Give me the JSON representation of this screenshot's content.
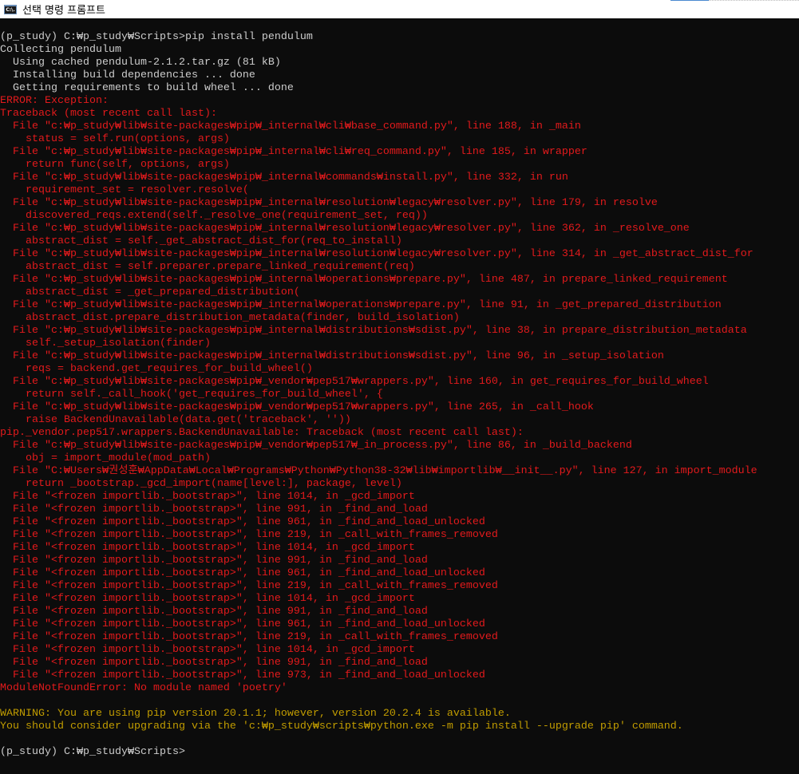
{
  "window": {
    "title": "선택 명령 프롬프트",
    "icon": "cmd-icon",
    "icon_text": "C:\\."
  },
  "colors": {
    "background": "#0c0c0c",
    "default": "#cccccc",
    "red": "#e31a1c",
    "yellow": "#c19c00"
  },
  "console_lines": [
    {
      "text": "(p_study) C:₩p_study₩Scripts>pip install pendulum",
      "color": "default"
    },
    {
      "text": "Collecting pendulum",
      "color": "default"
    },
    {
      "text": "  Using cached pendulum-2.1.2.tar.gz (81 kB)",
      "color": "default"
    },
    {
      "text": "  Installing build dependencies ... done",
      "color": "default"
    },
    {
      "text": "  Getting requirements to build wheel ... done",
      "color": "default"
    },
    {
      "text": "ERROR: Exception:",
      "color": "red"
    },
    {
      "text": "Traceback (most recent call last):",
      "color": "red"
    },
    {
      "text": "  File \"c:₩p_study₩lib₩site-packages₩pip₩_internal₩cli₩base_command.py\", line 188, in _main",
      "color": "red"
    },
    {
      "text": "    status = self.run(options, args)",
      "color": "red"
    },
    {
      "text": "  File \"c:₩p_study₩lib₩site-packages₩pip₩_internal₩cli₩req_command.py\", line 185, in wrapper",
      "color": "red"
    },
    {
      "text": "    return func(self, options, args)",
      "color": "red"
    },
    {
      "text": "  File \"c:₩p_study₩lib₩site-packages₩pip₩_internal₩commands₩install.py\", line 332, in run",
      "color": "red"
    },
    {
      "text": "    requirement_set = resolver.resolve(",
      "color": "red"
    },
    {
      "text": "  File \"c:₩p_study₩lib₩site-packages₩pip₩_internal₩resolution₩legacy₩resolver.py\", line 179, in resolve",
      "color": "red"
    },
    {
      "text": "    discovered_reqs.extend(self._resolve_one(requirement_set, req))",
      "color": "red"
    },
    {
      "text": "  File \"c:₩p_study₩lib₩site-packages₩pip₩_internal₩resolution₩legacy₩resolver.py\", line 362, in _resolve_one",
      "color": "red"
    },
    {
      "text": "    abstract_dist = self._get_abstract_dist_for(req_to_install)",
      "color": "red"
    },
    {
      "text": "  File \"c:₩p_study₩lib₩site-packages₩pip₩_internal₩resolution₩legacy₩resolver.py\", line 314, in _get_abstract_dist_for",
      "color": "red"
    },
    {
      "text": "    abstract_dist = self.preparer.prepare_linked_requirement(req)",
      "color": "red"
    },
    {
      "text": "  File \"c:₩p_study₩lib₩site-packages₩pip₩_internal₩operations₩prepare.py\", line 487, in prepare_linked_requirement",
      "color": "red"
    },
    {
      "text": "    abstract_dist = _get_prepared_distribution(",
      "color": "red"
    },
    {
      "text": "  File \"c:₩p_study₩lib₩site-packages₩pip₩_internal₩operations₩prepare.py\", line 91, in _get_prepared_distribution",
      "color": "red"
    },
    {
      "text": "    abstract_dist.prepare_distribution_metadata(finder, build_isolation)",
      "color": "red"
    },
    {
      "text": "  File \"c:₩p_study₩lib₩site-packages₩pip₩_internal₩distributions₩sdist.py\", line 38, in prepare_distribution_metadata",
      "color": "red"
    },
    {
      "text": "    self._setup_isolation(finder)",
      "color": "red"
    },
    {
      "text": "  File \"c:₩p_study₩lib₩site-packages₩pip₩_internal₩distributions₩sdist.py\", line 96, in _setup_isolation",
      "color": "red"
    },
    {
      "text": "    reqs = backend.get_requires_for_build_wheel()",
      "color": "red"
    },
    {
      "text": "  File \"c:₩p_study₩lib₩site-packages₩pip₩_vendor₩pep517₩wrappers.py\", line 160, in get_requires_for_build_wheel",
      "color": "red"
    },
    {
      "text": "    return self._call_hook('get_requires_for_build_wheel', {",
      "color": "red"
    },
    {
      "text": "  File \"c:₩p_study₩lib₩site-packages₩pip₩_vendor₩pep517₩wrappers.py\", line 265, in _call_hook",
      "color": "red"
    },
    {
      "text": "    raise BackendUnavailable(data.get('traceback', ''))",
      "color": "red"
    },
    {
      "text": "pip._vendor.pep517.wrappers.BackendUnavailable: Traceback (most recent call last):",
      "color": "red"
    },
    {
      "text": "  File \"c:₩p_study₩lib₩site-packages₩pip₩_vendor₩pep517₩_in_process.py\", line 86, in _build_backend",
      "color": "red"
    },
    {
      "text": "    obj = import_module(mod_path)",
      "color": "red"
    },
    {
      "text": "  File \"C:₩Users₩권성훈₩AppData₩Local₩Programs₩Python₩Python38-32₩lib₩importlib₩__init__.py\", line 127, in import_module",
      "color": "red"
    },
    {
      "text": "    return _bootstrap._gcd_import(name[level:], package, level)",
      "color": "red"
    },
    {
      "text": "  File \"<frozen importlib._bootstrap>\", line 1014, in _gcd_import",
      "color": "red"
    },
    {
      "text": "  File \"<frozen importlib._bootstrap>\", line 991, in _find_and_load",
      "color": "red"
    },
    {
      "text": "  File \"<frozen importlib._bootstrap>\", line 961, in _find_and_load_unlocked",
      "color": "red"
    },
    {
      "text": "  File \"<frozen importlib._bootstrap>\", line 219, in _call_with_frames_removed",
      "color": "red"
    },
    {
      "text": "  File \"<frozen importlib._bootstrap>\", line 1014, in _gcd_import",
      "color": "red"
    },
    {
      "text": "  File \"<frozen importlib._bootstrap>\", line 991, in _find_and_load",
      "color": "red"
    },
    {
      "text": "  File \"<frozen importlib._bootstrap>\", line 961, in _find_and_load_unlocked",
      "color": "red"
    },
    {
      "text": "  File \"<frozen importlib._bootstrap>\", line 219, in _call_with_frames_removed",
      "color": "red"
    },
    {
      "text": "  File \"<frozen importlib._bootstrap>\", line 1014, in _gcd_import",
      "color": "red"
    },
    {
      "text": "  File \"<frozen importlib._bootstrap>\", line 991, in _find_and_load",
      "color": "red"
    },
    {
      "text": "  File \"<frozen importlib._bootstrap>\", line 961, in _find_and_load_unlocked",
      "color": "red"
    },
    {
      "text": "  File \"<frozen importlib._bootstrap>\", line 219, in _call_with_frames_removed",
      "color": "red"
    },
    {
      "text": "  File \"<frozen importlib._bootstrap>\", line 1014, in _gcd_import",
      "color": "red"
    },
    {
      "text": "  File \"<frozen importlib._bootstrap>\", line 991, in _find_and_load",
      "color": "red"
    },
    {
      "text": "  File \"<frozen importlib._bootstrap>\", line 973, in _find_and_load_unlocked",
      "color": "red"
    },
    {
      "text": "ModuleNotFoundError: No module named 'poetry'",
      "color": "red"
    },
    {
      "text": "",
      "color": "default"
    },
    {
      "text": "WARNING: You are using pip version 20.1.1; however, version 20.2.4 is available.",
      "color": "yellow"
    },
    {
      "text": "You should consider upgrading via the 'c:₩p_study₩scripts₩python.exe -m pip install --upgrade pip' command.",
      "color": "yellow"
    },
    {
      "text": "",
      "color": "default"
    },
    {
      "text": "(p_study) C:₩p_study₩Scripts>",
      "color": "default"
    }
  ]
}
